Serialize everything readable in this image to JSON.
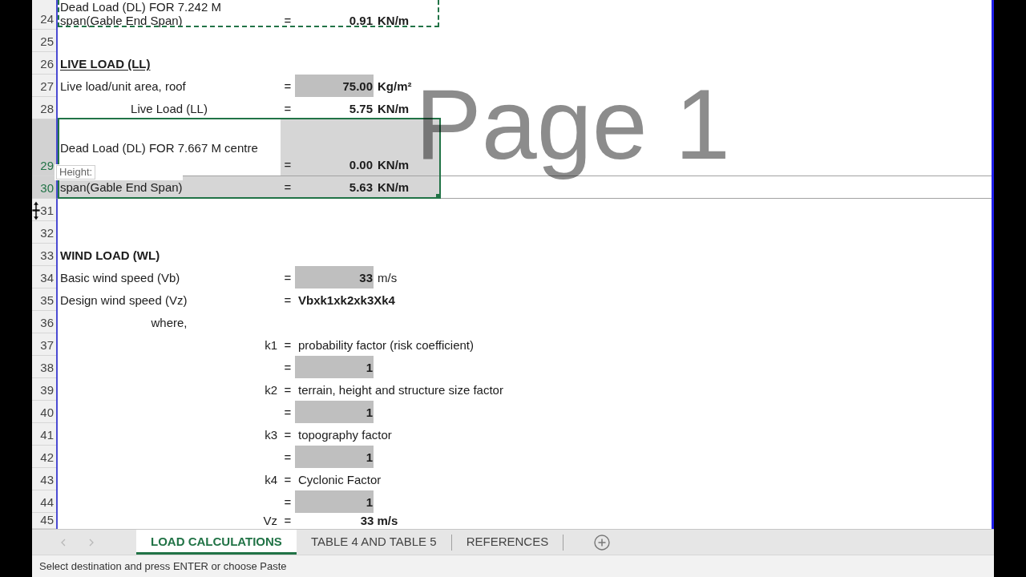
{
  "sheet": {
    "page_label": "Page 1",
    "rows": [
      {
        "number": "24",
        "kind": "entry",
        "label_lines": [
          "Dead Load (DL) FOR 7.242 M",
          "span(Gable End Span)"
        ],
        "eq": "=",
        "value": "0.91",
        "input": false,
        "unit": "KN/m",
        "unit_bold": true,
        "selected": false,
        "active": false,
        "copied": true
      },
      {
        "number": "25",
        "kind": "blank",
        "selected": false,
        "active": false,
        "copied": false
      },
      {
        "number": "26",
        "kind": "heading",
        "label": "LIVE LOAD (LL)",
        "underlined": true,
        "selected": false,
        "active": false,
        "copied": false
      },
      {
        "number": "27",
        "kind": "entry",
        "label": "Live load/unit area, roof",
        "eq": "=",
        "value": "75.00",
        "input": true,
        "unit": "Kg/m²",
        "unit_bold": true,
        "selected": false,
        "active": false,
        "copied": false
      },
      {
        "number": "28",
        "kind": "centered",
        "label": "Live Load (LL)",
        "eq": "=",
        "value": "5.75",
        "input": false,
        "unit": "KN/m",
        "unit_bold": true,
        "selected": false,
        "active": false,
        "copied": false
      },
      {
        "number": "29",
        "kind": "tall",
        "label": "Dead Load (DL) FOR 7.667 M centre",
        "eq": "=",
        "value": "0.00",
        "input": false,
        "unit": "KN/m",
        "unit_bold": true,
        "selected": true,
        "active": true,
        "copied": false
      },
      {
        "number": "30",
        "kind": "entry",
        "label": "span(Gable End Span)",
        "eq": "=",
        "value": "5.63",
        "input": false,
        "unit": "KN/m",
        "unit_bold": true,
        "selected": true,
        "active": false,
        "copied": false
      },
      {
        "number": "31",
        "kind": "blank",
        "selected": false,
        "active": false,
        "copied": false
      },
      {
        "number": "32",
        "kind": "blank",
        "selected": false,
        "active": false,
        "copied": false
      },
      {
        "number": "33",
        "kind": "heading",
        "label": "WIND LOAD (WL)",
        "underlined": false,
        "selected": false,
        "active": false,
        "copied": false
      },
      {
        "number": "34",
        "kind": "entry",
        "label": "Basic wind speed (Vb)",
        "eq": "=",
        "value": "33",
        "input": true,
        "unit": "m/s",
        "unit_bold": false,
        "selected": false,
        "active": false,
        "copied": false
      },
      {
        "number": "35",
        "kind": "formula",
        "label": "Design wind speed (Vz)",
        "eq": "=",
        "formula": "Vbxk1xk2xk3Xk4",
        "selected": false,
        "active": false,
        "copied": false
      },
      {
        "number": "36",
        "kind": "centered",
        "label": "where,",
        "selected": false,
        "active": false,
        "copied": false
      },
      {
        "number": "37",
        "kind": "factor",
        "symbol": "k1",
        "eq": "=",
        "description": "probability factor (risk coefficient)",
        "selected": false,
        "active": false,
        "copied": false
      },
      {
        "number": "38",
        "kind": "entry",
        "eq": "=",
        "value": "1",
        "input": true,
        "selected": false,
        "active": false,
        "copied": false
      },
      {
        "number": "39",
        "kind": "factor",
        "symbol": "k2",
        "eq": "=",
        "description": "terrain, height and structure size factor",
        "selected": false,
        "active": false,
        "copied": false
      },
      {
        "number": "40",
        "kind": "entry",
        "eq": "=",
        "value": "1",
        "input": true,
        "selected": false,
        "active": false,
        "copied": false
      },
      {
        "number": "41",
        "kind": "factor",
        "symbol": "k3",
        "eq": "=",
        "description": "topography factor",
        "selected": false,
        "active": false,
        "copied": false
      },
      {
        "number": "42",
        "kind": "entry",
        "eq": "=",
        "value": "1",
        "input": true,
        "selected": false,
        "active": false,
        "copied": false
      },
      {
        "number": "43",
        "kind": "factor",
        "symbol": "k4",
        "eq": "=",
        "description": "Cyclonic Factor",
        "selected": false,
        "active": false,
        "copied": false
      },
      {
        "number": "44",
        "kind": "entry",
        "eq": "=",
        "value": "1",
        "input": true,
        "selected": false,
        "active": false,
        "copied": false
      },
      {
        "number": "45",
        "kind": "result",
        "symbol": "Vz",
        "eq": "=",
        "result": "33 m/s",
        "selected": false,
        "active": false,
        "copied": false
      }
    ]
  },
  "row_height_tooltip": {
    "label": "Height:"
  },
  "sheet_tabs": {
    "back_disabled": true,
    "forward_disabled": true,
    "tabs": [
      {
        "label": "LOAD CALCULATIONS",
        "selected": true
      },
      {
        "label": "TABLE 4 AND TABLE 5",
        "selected": false
      },
      {
        "label": "REFERENCES",
        "selected": false
      }
    ]
  },
  "status_bar": {
    "message": "Select destination and press ENTER or choose Paste"
  }
}
